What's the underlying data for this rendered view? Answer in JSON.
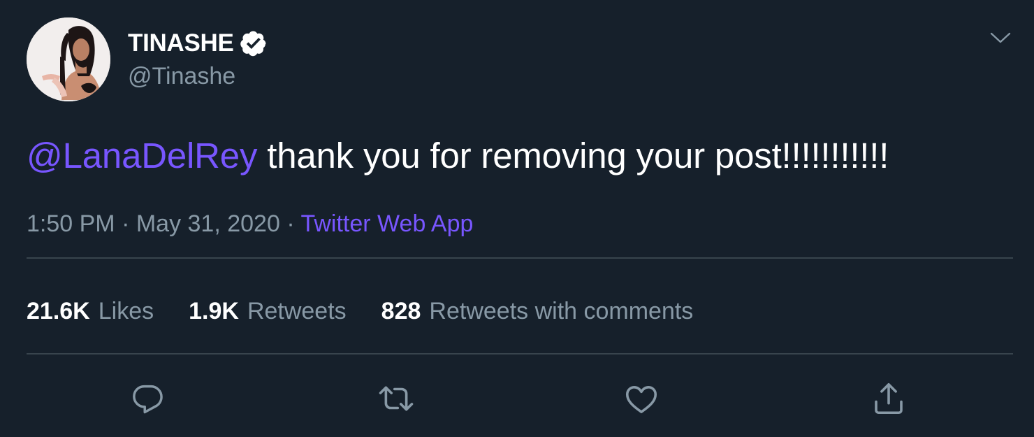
{
  "tweet": {
    "author": {
      "display_name": "TINASHE",
      "handle": "@Tinashe",
      "verified": true
    },
    "text": {
      "mention": "@LanaDelRey",
      "body": " thank you for removing your post!!!!!!!!!!!"
    },
    "meta": {
      "time": "1:50 PM",
      "separator": " · ",
      "date": "May 31, 2020",
      "source": "Twitter Web App"
    },
    "stats": [
      {
        "count": "21.6K",
        "label": "Likes"
      },
      {
        "count": "1.9K",
        "label": "Retweets"
      },
      {
        "count": "828",
        "label": "Retweets with comments"
      }
    ],
    "actions": [
      "reply-icon",
      "retweet-icon",
      "like-icon",
      "share-icon"
    ]
  },
  "colors": {
    "background": "#16202b",
    "accent": "#7856ff",
    "secondary_text": "#8899a6",
    "divider": "#38444d"
  }
}
